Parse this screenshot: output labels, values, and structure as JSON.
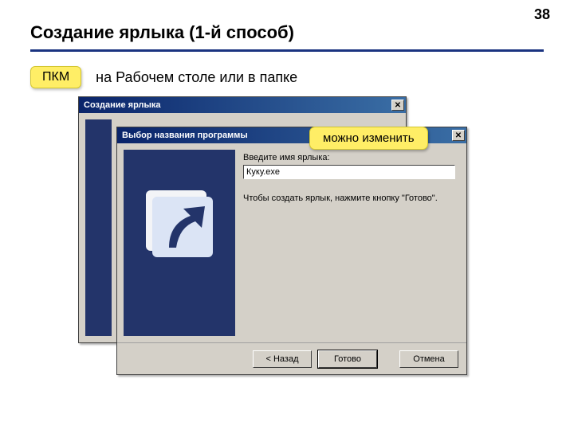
{
  "page_number": "38",
  "page_title": "Создание ярлыка (1-й способ)",
  "hint": {
    "badge": "ПКМ",
    "text": "на Рабочем столе или в папке"
  },
  "dialog_back": {
    "title": "Создание ярлыка"
  },
  "dialog_front": {
    "title": "Выбор названия программы",
    "field_label": "Введите имя ярлыка:",
    "input_value": "Куку.exe",
    "instruction": "Чтобы создать ярлык, нажмите кнопку \"Готово\".",
    "buttons": {
      "back": "< Назад",
      "finish": "Готово",
      "cancel": "Отмена"
    }
  },
  "callout_change": "можно изменить"
}
